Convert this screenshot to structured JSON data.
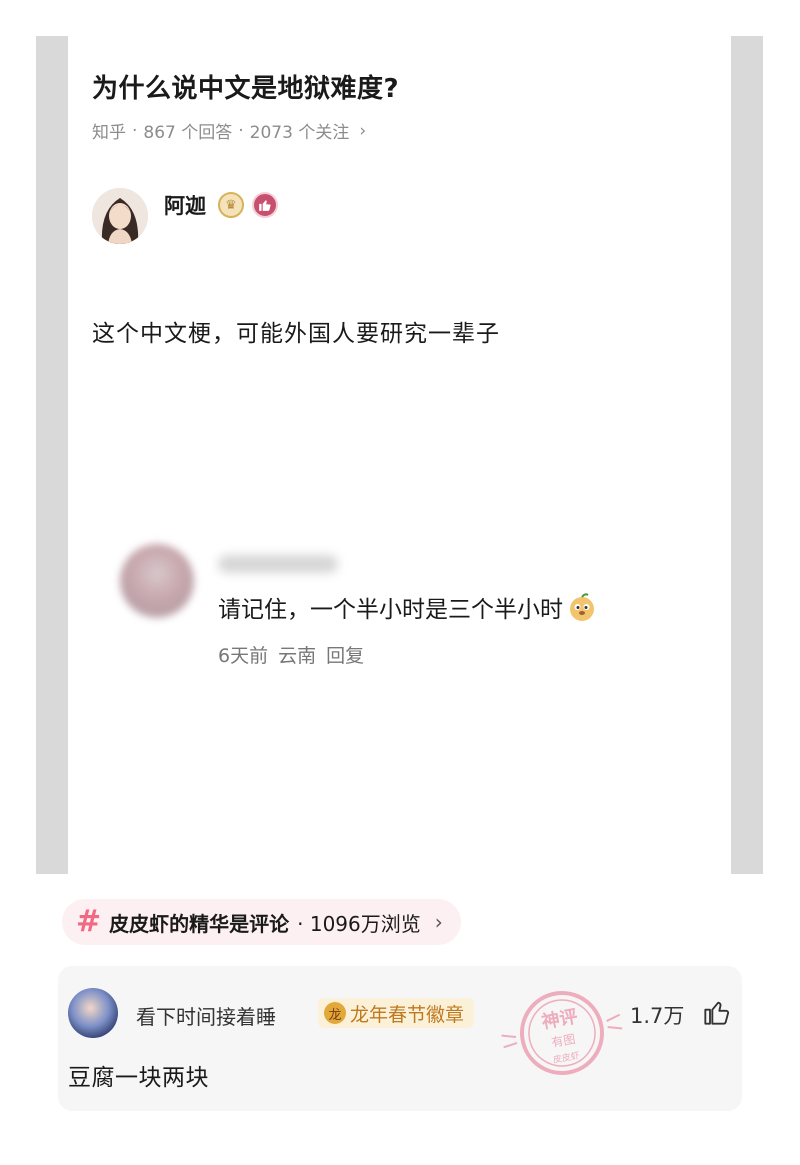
{
  "question": {
    "title": "为什么说中文是地狱难度?",
    "source": "知乎",
    "answers": "867 个回答",
    "followers": "2073 个关注",
    "separator": "·"
  },
  "author": {
    "name": "阿迦"
  },
  "answer": {
    "text": "这个中文梗，可能外国人要研究一辈子"
  },
  "reply": {
    "text": "请记住，一个半小时是三个半小时",
    "time": "6天前",
    "location": "云南",
    "reply_label": "回复"
  },
  "topic": {
    "name": "皮皮虾的精华是评论",
    "views": "· 1096万浏览",
    "hash_icon": "hash-icon",
    "accent": "#f06a84"
  },
  "comment": {
    "username": "看下时间接着睡",
    "badge_label": "龙年春节徽章",
    "like_count": "1.7万",
    "body": "豆腐一块两块",
    "stamp_text": [
      "神评",
      "有图",
      "皮皮虾"
    ],
    "stamp_color": "#e8728c"
  }
}
